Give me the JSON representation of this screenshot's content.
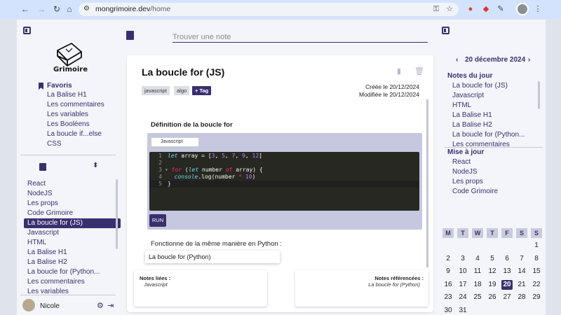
{
  "browser": {
    "url_host": "mongrimoire.dev",
    "url_path": "/home"
  },
  "sidebar": {
    "logo_text": "Grimoire",
    "favorites_title": "Favoris",
    "favorites": [
      "La Balise H1",
      "Les commentaires",
      "Les variables",
      "Les Booléens",
      "La boucle if...else",
      "CSS"
    ],
    "notes": [
      "React",
      "NodeJS",
      "Les props",
      "Code Grimoire",
      "La boucle for (JS)",
      "Javascript",
      "HTML",
      "La Balise H1",
      "La Balise H2",
      "La boucle for (Python...",
      "Les commentaires",
      "Les variables"
    ],
    "active_note_index": 4,
    "user_name": "Nicole"
  },
  "search": {
    "placeholder": "Trouver une note"
  },
  "note": {
    "title": "La boucle for (JS)",
    "tags": [
      "javascript",
      "algo"
    ],
    "add_tag_label": "+ Tag",
    "created": "Créée le 20/12/2024",
    "modified": "Modifiée le 20/12/2024",
    "section_title": "Définition de la boucle for",
    "code_language": "Javascript",
    "code_lines": [
      "1",
      "2",
      "3",
      "4",
      "5"
    ],
    "run_label": "RUN",
    "paragraph": "Fonctionne de la même manière en Python :",
    "link_suggestion": "La boucle for (Python)",
    "linked_title": "Notes liées :",
    "linked_value": "Javascript",
    "referenced_title": "Notes référencées :",
    "referenced_value": "La boucle for (Python)"
  },
  "right_panel": {
    "date": "20 décembre 2024",
    "day_notes_title": "Notes du jour",
    "day_notes": [
      "La boucle for (JS)",
      "Javascript",
      "HTML",
      "La Balise H1",
      "La Balise H2",
      "La boucle for (Python...",
      "Les commentaires"
    ],
    "updated_title": "Mise à jour",
    "updated": [
      "React",
      "NodeJS",
      "Les props",
      "Code Grimoire"
    ],
    "weekdays": [
      "M",
      "T",
      "W",
      "T",
      "F",
      "S",
      "S"
    ],
    "days": [
      "1",
      "2",
      "3",
      "4",
      "5",
      "6",
      "7",
      "8",
      "9",
      "10",
      "11",
      "12",
      "13",
      "14",
      "15",
      "16",
      "17",
      "18",
      "19",
      "20",
      "21",
      "22",
      "23",
      "24",
      "25",
      "26",
      "27",
      "28",
      "29",
      "30",
      "31"
    ],
    "first_day_column": 6,
    "today": "20"
  },
  "colors": {
    "accent": "#3a2f6e",
    "editor_bg": "#272822"
  }
}
